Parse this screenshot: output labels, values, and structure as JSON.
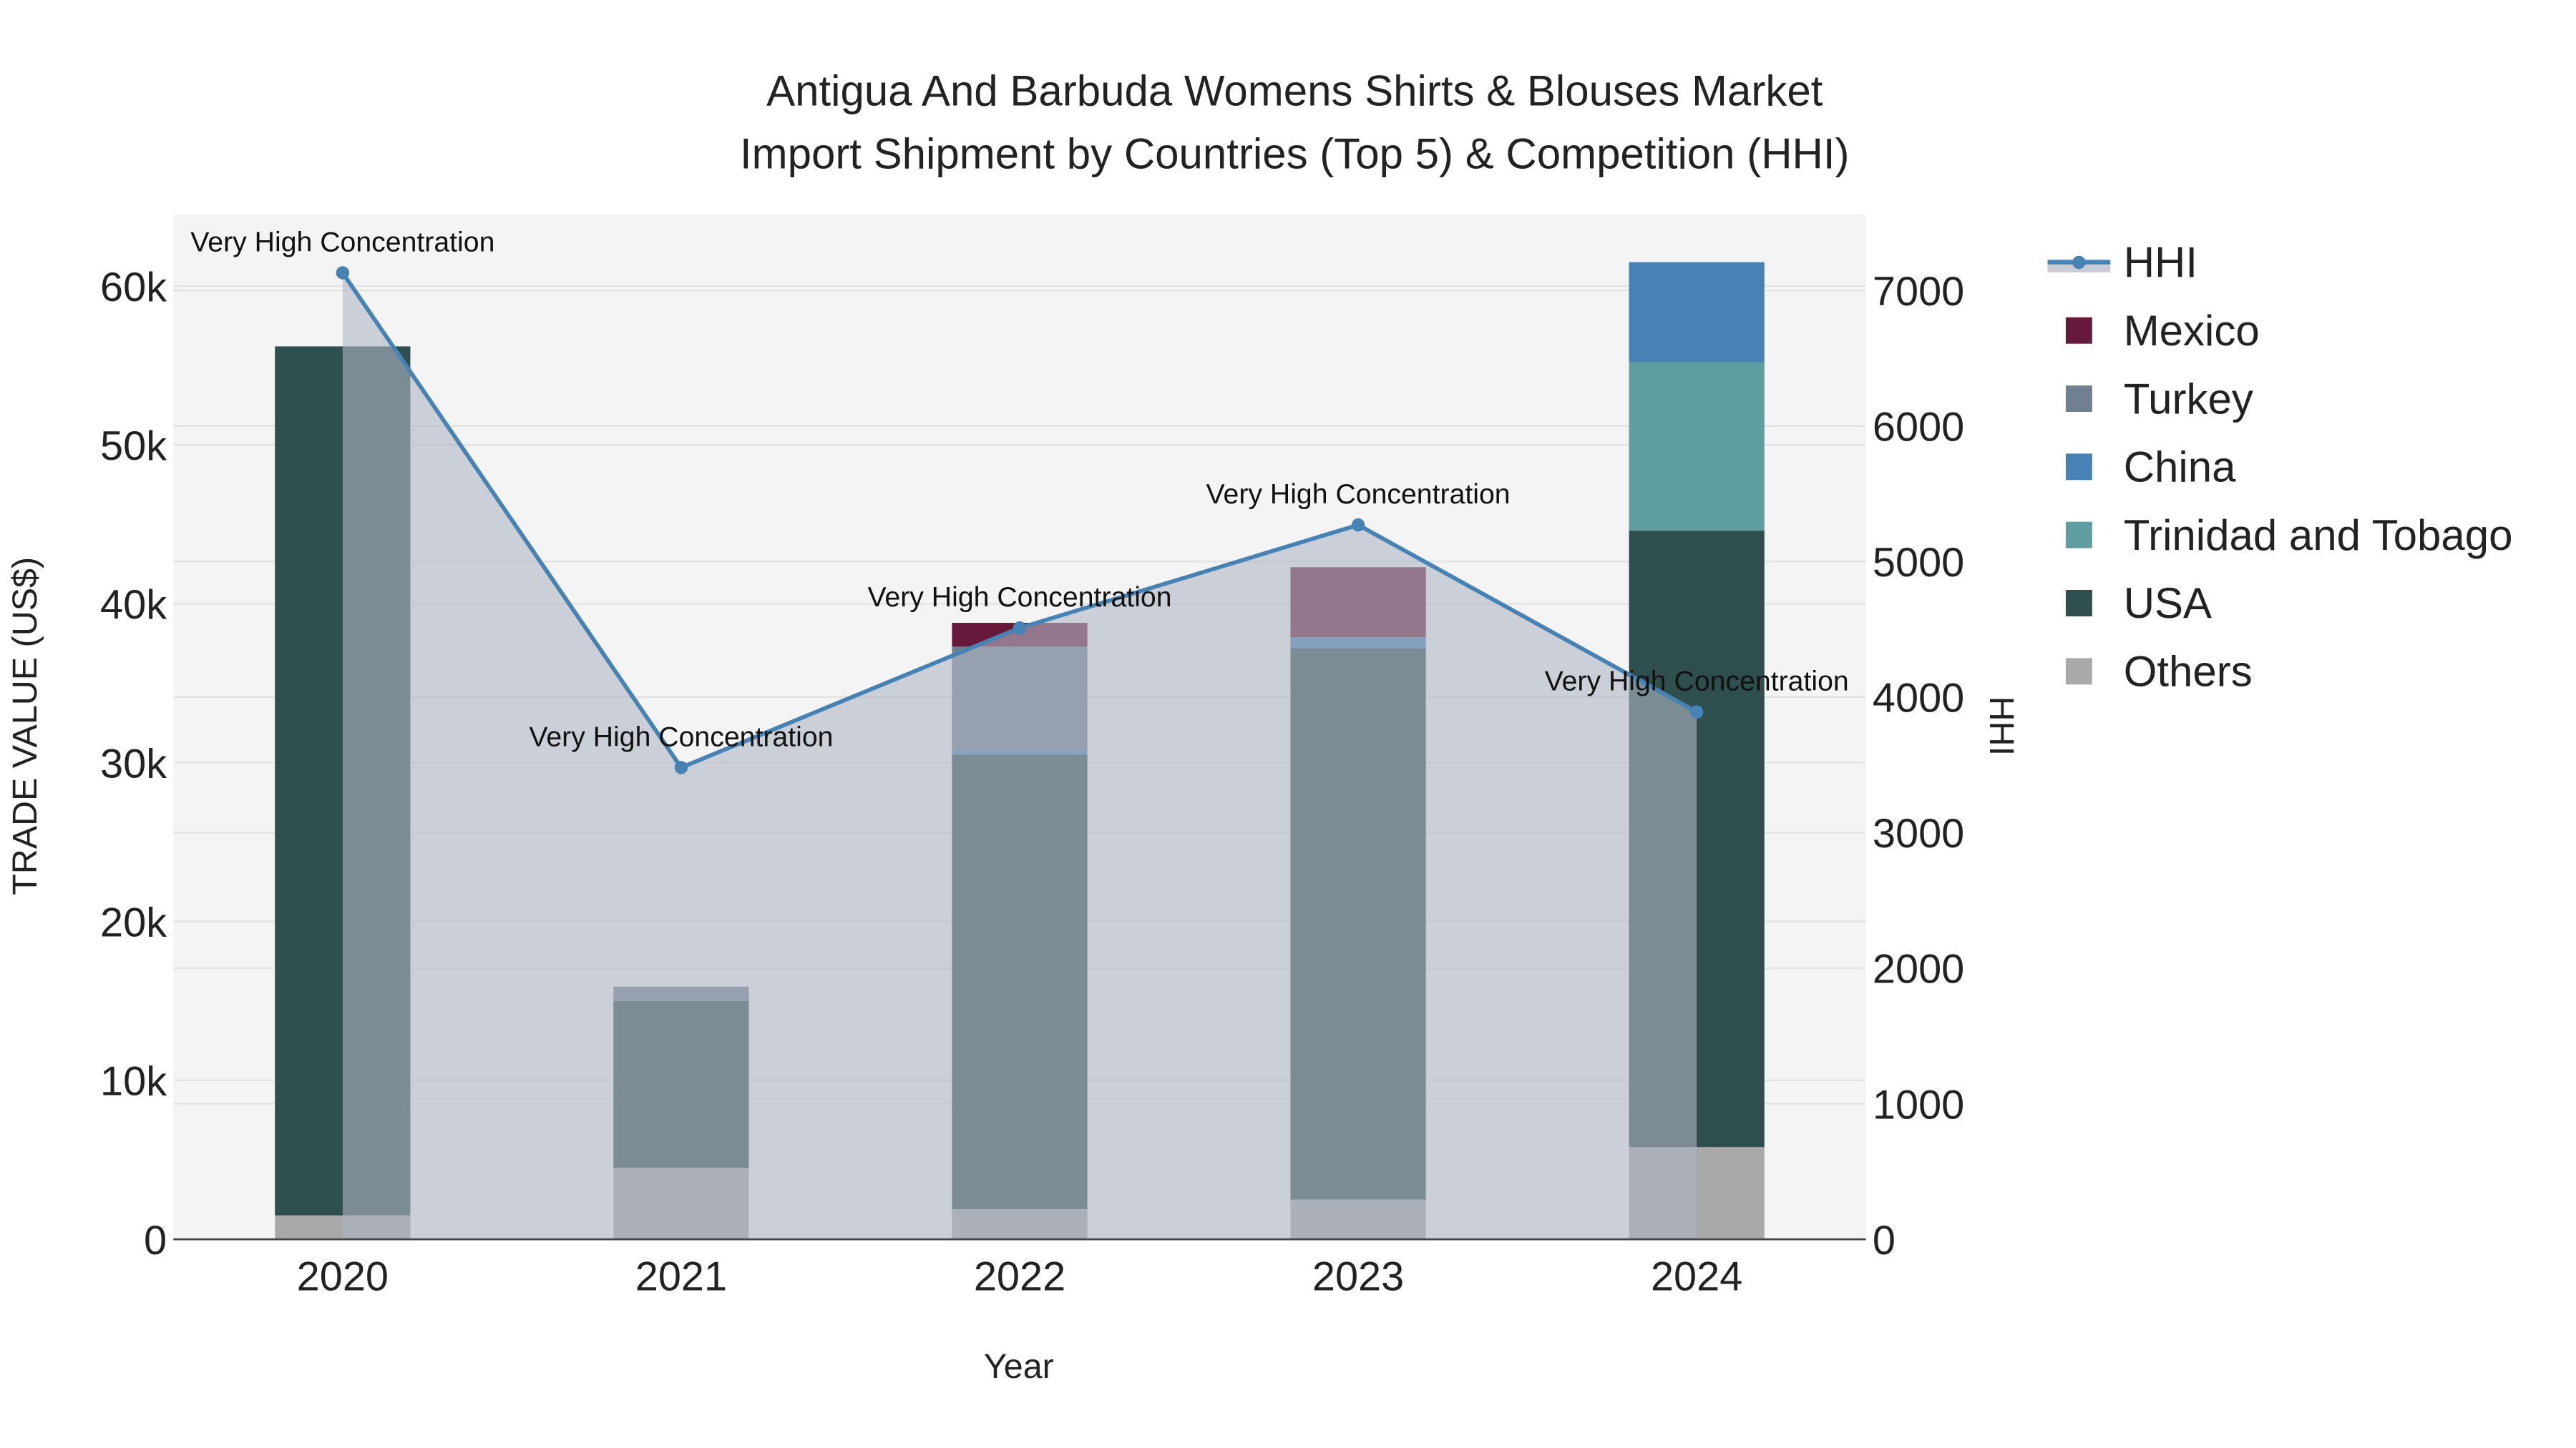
{
  "chart_data": {
    "type": "bar",
    "title_lines": [
      "Antigua And Barbuda Womens Shirts & Blouses Market",
      "Import Shipment by Countries (Top 5) & Competition (HHI)"
    ],
    "xlabel": "Year",
    "ylabel": "TRADE VALUE (US$)",
    "y2label": "HHI",
    "categories": [
      "2020",
      "2021",
      "2022",
      "2023",
      "2024"
    ],
    "ylim": [
      0,
      64500
    ],
    "y2lim": [
      0,
      7560
    ],
    "yticks": [
      0,
      10000,
      20000,
      30000,
      40000,
      50000,
      60000
    ],
    "ytick_labels": [
      "0",
      "10k",
      "20k",
      "30k",
      "40k",
      "50k",
      "60k"
    ],
    "y2ticks": [
      0,
      1000,
      2000,
      3000,
      4000,
      5000,
      6000,
      7000
    ],
    "y2tick_labels": [
      "0",
      "1000",
      "2000",
      "3000",
      "4000",
      "5000",
      "6000",
      "7000"
    ],
    "stack_order": [
      "Others",
      "USA",
      "Trinidad and Tobago",
      "China",
      "Turkey",
      "Mexico"
    ],
    "series": [
      {
        "name": "Others",
        "color": "#a9a9a9",
        "values": [
          1500,
          4500,
          1900,
          2500,
          5800
        ]
      },
      {
        "name": "USA",
        "color": "#2f4f4f",
        "values": [
          54700,
          10500,
          28600,
          34700,
          38800
        ]
      },
      {
        "name": "Trinidad and Tobago",
        "color": "#5f9ea0",
        "values": [
          0,
          0,
          0,
          0,
          10600
        ]
      },
      {
        "name": "China",
        "color": "#4682b4",
        "values": [
          0,
          0,
          300,
          700,
          6300
        ]
      },
      {
        "name": "Turkey",
        "color": "#708090",
        "values": [
          0,
          900,
          6500,
          0,
          0
        ]
      },
      {
        "name": "Mexico",
        "color": "#67193b",
        "values": [
          0,
          0,
          1500,
          4400,
          0
        ]
      }
    ],
    "hhi": {
      "name": "HHI",
      "color": "#4682b4",
      "values": [
        7130,
        3480,
        4510,
        5270,
        3890
      ]
    },
    "annotations": [
      "Very High Concentration",
      "Very High Concentration",
      "Very High Concentration",
      "Very High Concentration",
      "Very High Concentration"
    ],
    "legend": [
      "HHI",
      "Mexico",
      "Turkey",
      "China",
      "Trinidad and Tobago",
      "USA",
      "Others"
    ],
    "legend_placement": "right",
    "grid": true
  }
}
